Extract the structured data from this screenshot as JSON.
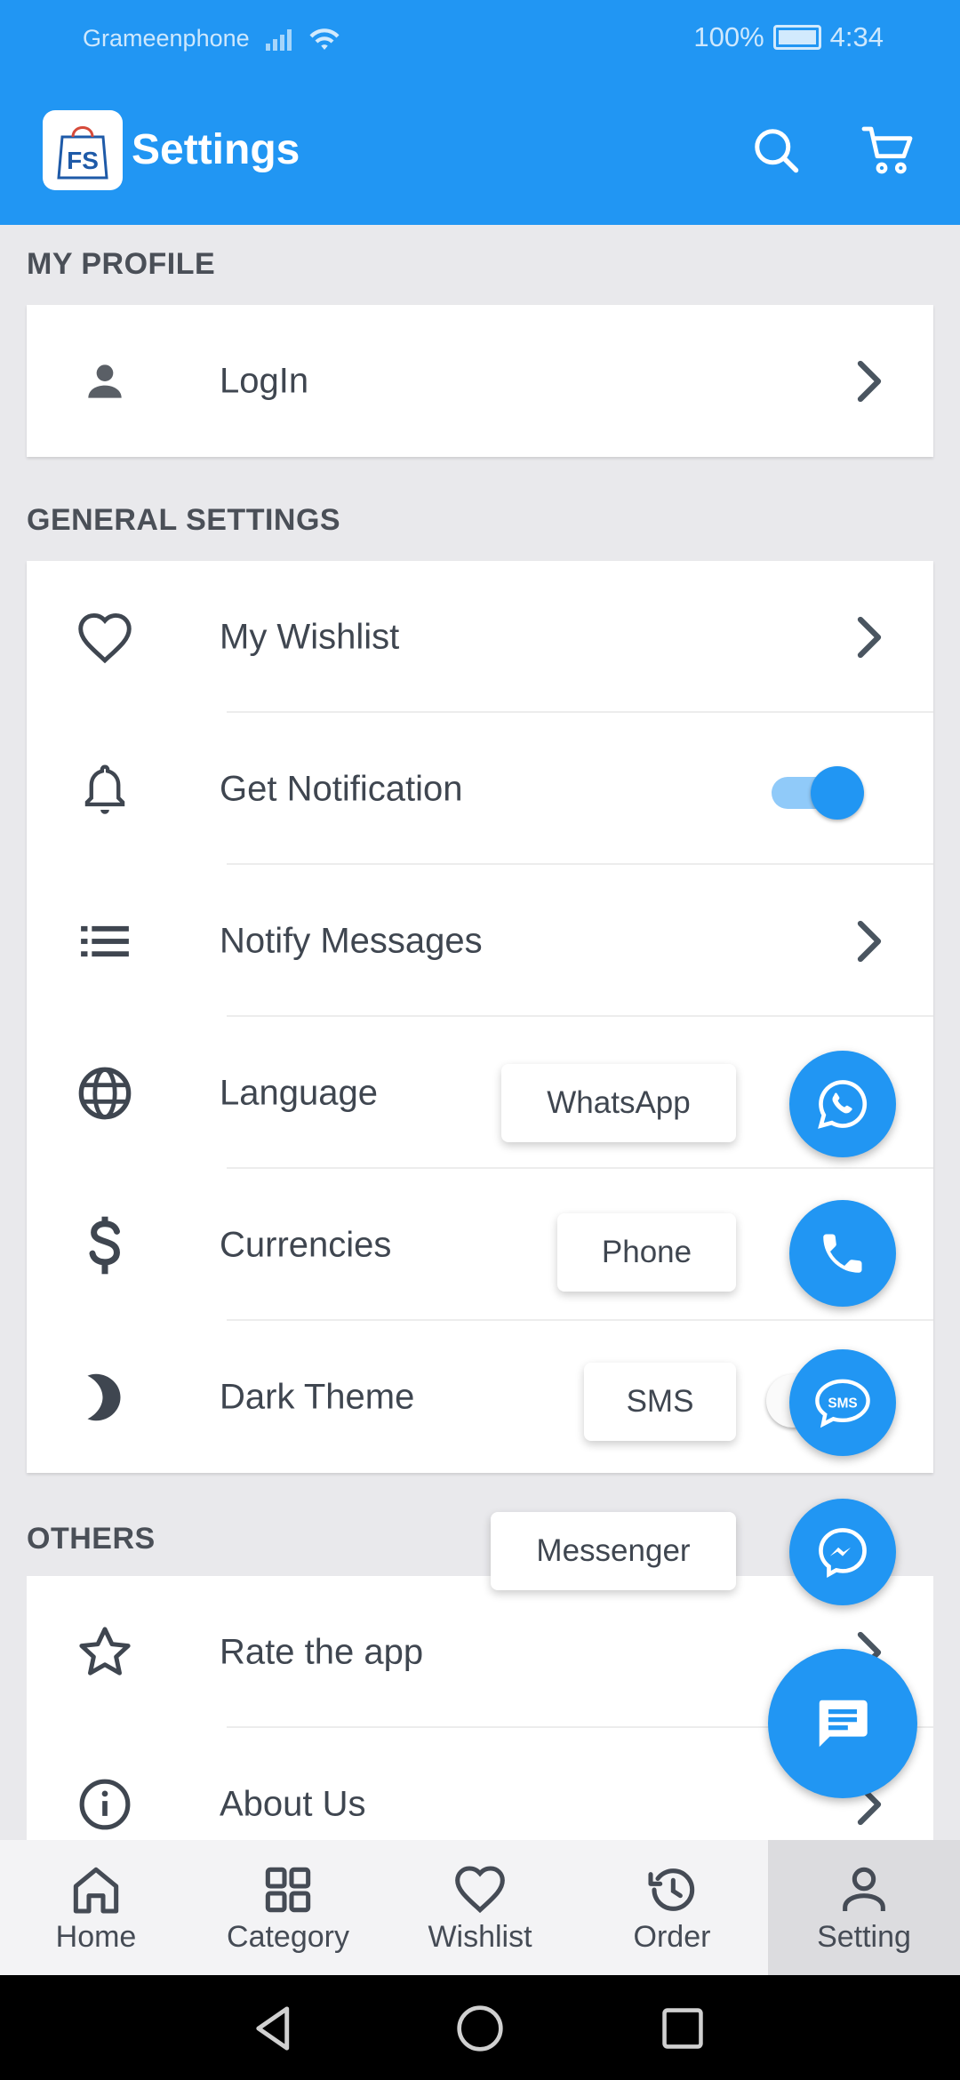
{
  "status_bar": {
    "carrier": "Grameenphone",
    "battery": "100%",
    "time": "4:34"
  },
  "app_bar": {
    "title": "Settings",
    "logo_text": "FS"
  },
  "sections": {
    "profile": {
      "title": "MY PROFILE",
      "login_label": "LogIn"
    },
    "general": {
      "title": "GENERAL SETTINGS",
      "wishlist_label": "My Wishlist",
      "notification_label": "Get Notification",
      "notification_on": true,
      "notify_messages_label": "Notify Messages",
      "language_label": "Language",
      "currencies_label": "Currencies",
      "dark_theme_label": "Dark Theme",
      "dark_theme_on": false
    },
    "others": {
      "title": "OTHERS",
      "rate_label": "Rate the app",
      "about_label": "About Us"
    }
  },
  "contact_menu": {
    "whatsapp_label": "WhatsApp",
    "phone_label": "Phone",
    "sms_label": "SMS",
    "messenger_label": "Messenger",
    "sms_icon_text": "SMS"
  },
  "bottom_nav": {
    "home": "Home",
    "category": "Category",
    "wishlist": "Wishlist",
    "order": "Order",
    "setting": "Setting",
    "active": "setting"
  },
  "colors": {
    "primary": "#2196f3",
    "toggle_track": "#90caf9",
    "background": "#e9e9ec"
  }
}
